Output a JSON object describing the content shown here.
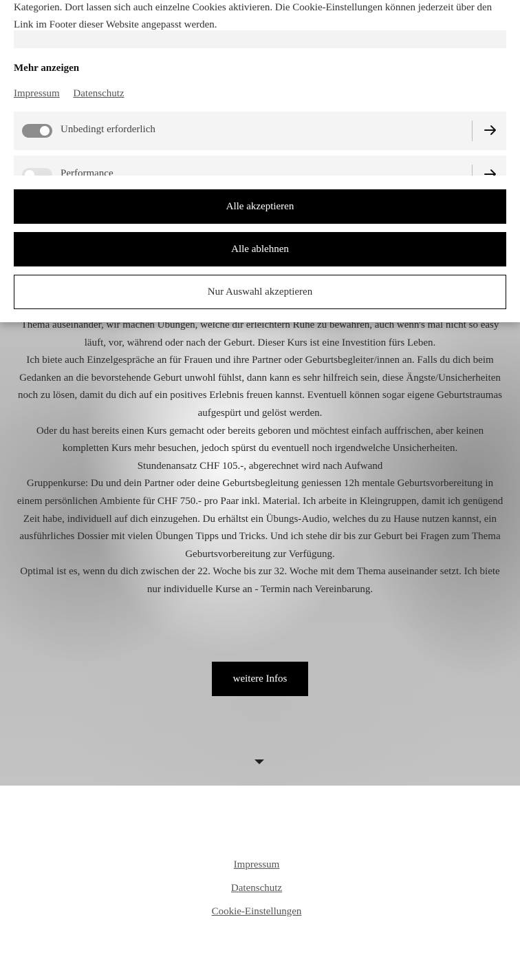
{
  "cookie_banner": {
    "intro_lines": [
      "Kategorien. Dort lassen sich auch einzelne Cookies aktivieren. Die Cookie-Einstellungen können jederzeit über den",
      "Link im Footer dieser Website angepasst werden."
    ],
    "show_more": "Mehr anzeigen",
    "links": {
      "impressum": "Impressum",
      "datenschutz": "Datenschutz"
    },
    "categories": [
      {
        "label": "Unbedingt erforderlich",
        "enabled": true
      },
      {
        "label": "Performance",
        "enabled": false
      }
    ],
    "buttons": {
      "accept_all": "Alle akzeptieren",
      "reject_all": "Alle ablehnen",
      "accept_selection": "Nur Auswahl akzeptieren"
    }
  },
  "main": {
    "paragraphs": [
      "Thema auseinander, wir machen Übungen, welche dir erleichtern Ruhe zu bewahren, auch wenn's mal nicht so easy läuft, vor, während oder nach der Geburt. Dieser Kurs ist eine Investition fürs Leben.",
      "Ich biete auch Einzelgespräche an für Frauen und ihre Partner oder Geburtsbegleiter/innen an. Falls du dich beim Gedanken an die bevorstehende Geburt unwohl fühlst, dann kann es sehr hilfreich sein, diese Ängste/Unsicherheiten noch zu lösen, damit du dich auf ein positives Erlebnis freuen kannst. Eventuell können sogar eigene Geburtstraumas aufgespürt und gelöst werden.",
      "Oder du hast bereits einen Kurs gemacht oder bereits geboren und möchtest einfach auffrischen, aber keinen kompletten Kurs mehr besuchen, jedoch spürst du eventuell noch irgendwelche Unsicherheiten.",
      "Stundenansatz CHF 105.-, abgerechnet wird nach Aufwand",
      "Gruppenkurse: Du und dein Partner oder deine Geburtsbegleitung geniessen 12h mentale Geburtsvorbereitung in einem persönlichen Ambiente für CHF 750.- pro Paar inkl. Material. Ich arbeite in Kleingruppen, damit ich genügend Zeit habe, individuell auf dich einzugehen. Du erhältst ein Übungs-Audio, welches du zu Hause nutzen kannst, ein ausführliches Dossier mit vielen Übungen Tipps und Tricks. Und ich stehe dir bis zur Geburt bei Fragen zum Thema Geburtsvorbereitung zur Verfügung.",
      "Optimal ist es, wenn du dich zwischen der 22. Woche bis zur 32. Woche mit dem Thema auseinander setzt. Ich biete nur individuelle Kurse an - Termin nach Vereinbarung."
    ],
    "more_button": "weitere Infos"
  },
  "footer": {
    "impressum": "Impressum",
    "datenschutz": "Datenschutz",
    "cookie_settings": "Cookie-Einstellungen"
  },
  "icons": {
    "arrow": "arrow-right-icon",
    "scroll": "triangle-down-icon"
  }
}
